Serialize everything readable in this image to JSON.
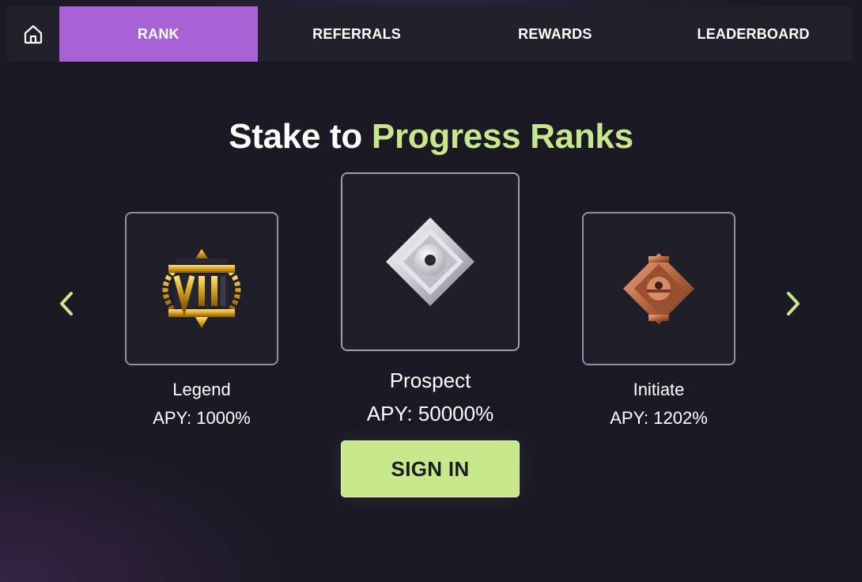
{
  "nav": {
    "home_icon": "home-icon",
    "tabs": [
      {
        "label": "RANK",
        "active": true
      },
      {
        "label": "REFERRALS",
        "active": false
      },
      {
        "label": "REWARDS",
        "active": false
      },
      {
        "label": "LEADERBOARD",
        "active": false
      }
    ]
  },
  "hero": {
    "title_prefix": "Stake to ",
    "title_accent": "Progress Ranks"
  },
  "ranks": [
    {
      "name": "Legend",
      "apy": "APY: 1000%",
      "icon": "legend-rank-icon"
    },
    {
      "name": "Prospect",
      "apy": "APY: 50000%",
      "icon": "prospect-rank-icon"
    },
    {
      "name": "Initiate",
      "apy": "APY: 1202%",
      "icon": "initiate-rank-icon"
    }
  ],
  "carousel": {
    "prev_icon": "chevron-left-icon",
    "next_icon": "chevron-right-icon"
  },
  "signin_label": "SIGN IN",
  "colors": {
    "active_tab": "#a961d6",
    "accent_green": "#c6e78c",
    "button_green": "#c8e88c",
    "background": "#1b1924",
    "card_border": "#9a89ad"
  }
}
